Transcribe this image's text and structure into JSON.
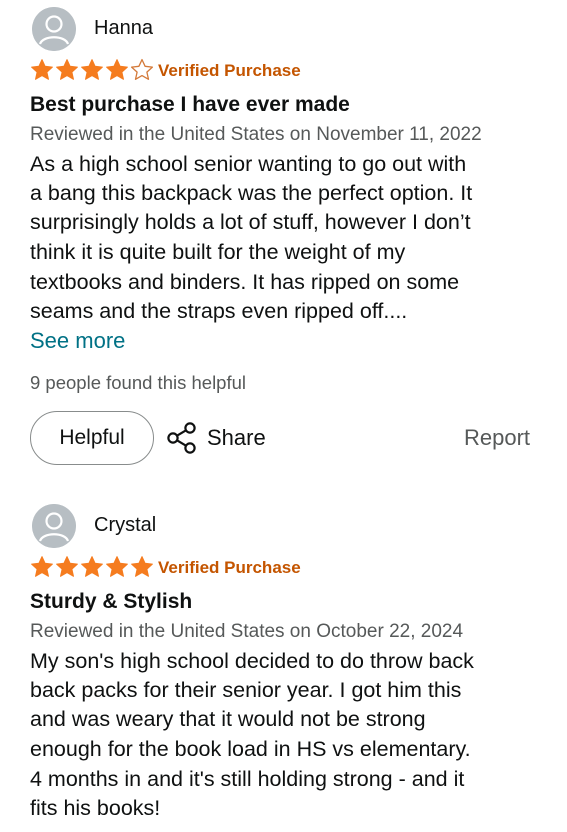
{
  "reviews": [
    {
      "name": "Hanna",
      "rating": 4,
      "max_rating": 5,
      "verified": "Verified Purchase",
      "title": "Best purchase I have ever made",
      "meta": "Reviewed in the United States on November 11, 2022",
      "body_lines": [
        "As a high school senior wanting to go out with",
        "a bang this backpack was the perfect option. It",
        "surprisingly holds a lot of stuff, however I don’t",
        "think it is quite built for the weight of my",
        "textbooks and binders. It has ripped on some",
        "seams and the straps even ripped off...."
      ],
      "see_more": "See more",
      "helpful_count": "9 people found this helpful",
      "helpful_label": "Helpful",
      "share_label": "Share",
      "report_label": "Report"
    },
    {
      "name": "Crystal",
      "rating": 5,
      "max_rating": 5,
      "verified": "Verified Purchase",
      "title": "Sturdy & Stylish",
      "meta": "Reviewed in the United States on October 22, 2024",
      "body_lines": [
        "My son's high school decided to do throw back",
        "back packs for their senior year. I got him this",
        "and was weary that it would not be strong",
        "enough for the book load in HS vs elementary.",
        "4 months in and it's still holding strong - and it",
        "fits his books!"
      ]
    }
  ],
  "colors": {
    "star_fill": "#f57c1f",
    "verified": "#c45500",
    "link": "#007185",
    "muted": "#565959"
  }
}
